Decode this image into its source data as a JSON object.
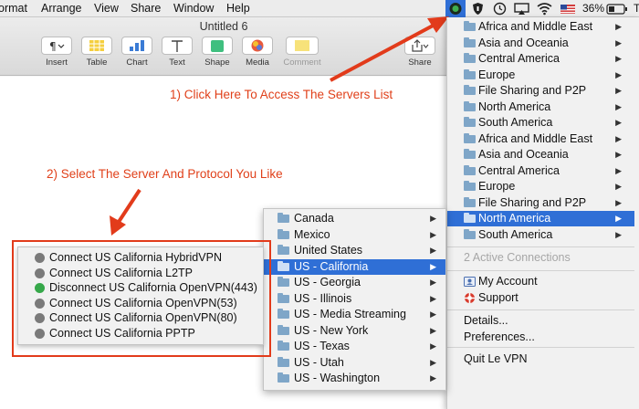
{
  "menubar": {
    "items": [
      "ormat",
      "Arrange",
      "View",
      "Share",
      "Window",
      "Help"
    ],
    "battery_percent": "36%",
    "partial_right": "T"
  },
  "window": {
    "title": "Untitled 6",
    "toolbar": {
      "insert": "Insert",
      "table": "Table",
      "chart": "Chart",
      "text": "Text",
      "shape": "Shape",
      "media": "Media",
      "comment": "Comment",
      "share": "Share"
    }
  },
  "annotations": {
    "step1": "1) Click Here To Access The Servers List",
    "step2": "2) Select The Server And Protocol You Like"
  },
  "vpn_menu": {
    "regions": [
      "Africa and Middle East",
      "Asia and Oceania",
      "Central America",
      "Europe",
      "File Sharing and P2P",
      "North America",
      "South America",
      "Africa and Middle East",
      "Asia and Oceania",
      "Central America",
      "Europe",
      "File Sharing and P2P",
      "North America",
      "South America"
    ],
    "status": "2 Active Connections",
    "my_account": "My Account",
    "support": "Support",
    "details": "Details...",
    "preferences": "Preferences...",
    "quit": "Quit Le VPN"
  },
  "north_america_menu": {
    "items": [
      "Canada",
      "Mexico",
      "United States",
      "US - California",
      "US - Georgia",
      "US - Illinois",
      "US - Media Streaming",
      "US - New York",
      "US - Texas",
      "US - Utah",
      "US - Washington"
    ]
  },
  "protocol_menu": {
    "items": [
      "Connect US California HybridVPN",
      "Connect US California L2TP",
      "Disconnect US California OpenVPN(443)",
      "Connect US California OpenVPN(53)",
      "Connect US California OpenVPN(80)",
      "Connect US California PPTP"
    ]
  },
  "colors": {
    "highlight": "#2f6fd6",
    "annotation": "#e0401a",
    "connected": "#36a84a"
  }
}
